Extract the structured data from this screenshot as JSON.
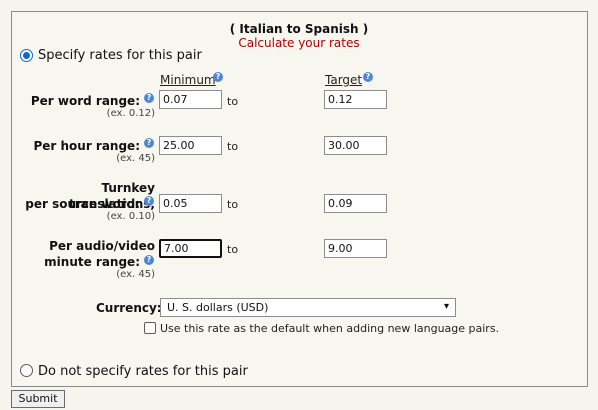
{
  "header": {
    "pair_title": "( Italian to Spanish )",
    "subtitle": "Calculate your rates"
  },
  "mode": {
    "specify_label": "Specify rates for this pair",
    "no_specify_label": "Do not specify rates for this pair",
    "selected": "specify"
  },
  "columns": {
    "minimum": "Minimum",
    "target": "Target"
  },
  "rows": [
    {
      "label_line1": "Per word range:",
      "label_line2": "",
      "example": "(ex. 0.12)",
      "min": "0.07",
      "target": "0.12"
    },
    {
      "label_line1": "Per hour range:",
      "label_line2": "",
      "example": "(ex. 45)",
      "min": "25.00",
      "target": "30.00"
    },
    {
      "label_line1": "Turnkey translations,",
      "label_line2": "per source word:",
      "example": "(ex. 0.10)",
      "min": "0.05",
      "target": "0.09"
    },
    {
      "label_line1": "Per audio/video",
      "label_line2": "minute range:",
      "example": "(ex. 45)",
      "min": "7.00",
      "target": "9.00"
    }
  ],
  "to_label": "to",
  "help_glyph": "?",
  "currency": {
    "label": "Currency:",
    "value": "U. S. dollars (USD)",
    "chevron": "▾"
  },
  "default_checkbox": {
    "label": "Use this rate as the default when adding new language pairs.",
    "checked": false
  },
  "submit_label": "Submit",
  "colors": {
    "accent": "#0a6ad4",
    "subtitle": "#b00000",
    "help_icon": "#4f86d6"
  }
}
